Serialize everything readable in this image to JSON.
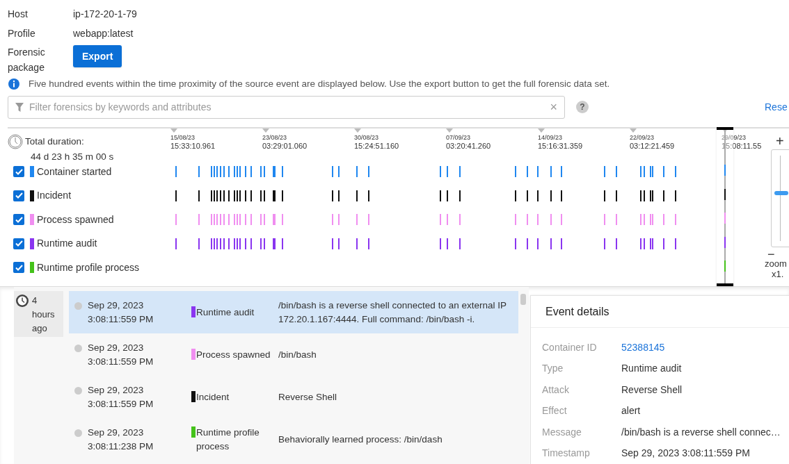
{
  "summary": [
    {
      "label": "Host",
      "value": "ip-172-20-1-79"
    },
    {
      "label": "Profile",
      "value": "webapp:latest"
    }
  ],
  "forensic_package": {
    "label": "Forensic package",
    "button": "Export"
  },
  "info": "Five hundred events within the time proximity of the source event are displayed below. Use the export button to get the full forensic data set.",
  "filter": {
    "placeholder": "Filter forensics by keywords and attributes",
    "clear": "×",
    "help": "?"
  },
  "reset": "Rese",
  "timeline": {
    "total_label": "Total duration:",
    "total_value": "44 d 23 h 35 m 00 s",
    "axis": [
      {
        "date": "15/08/23",
        "time": "15:33:10.961"
      },
      {
        "date": "23/08/23",
        "time": "03:29:01.060"
      },
      {
        "date": "30/08/23",
        "time": "15:24:51.160"
      },
      {
        "date": "07/09/23",
        "time": "03:20:41.260"
      },
      {
        "date": "14/09/23",
        "time": "15:16:31.359"
      },
      {
        "date": "22/09/23",
        "time": "03:12:21.459"
      },
      {
        "date": "29/09/23",
        "time": "15:08:11.55"
      }
    ],
    "series": [
      {
        "name": "Container started",
        "checked": true,
        "color": "#1f87f0"
      },
      {
        "name": "Incident",
        "checked": true,
        "color": "#111111"
      },
      {
        "name": "Process spawned",
        "checked": true,
        "color": "#f08ef0"
      },
      {
        "name": "Runtime audit",
        "checked": true,
        "color": "#8a35f0"
      },
      {
        "name": "Runtime profile process",
        "checked": true,
        "color": "#44c21a"
      }
    ],
    "zoom": {
      "plus": "+",
      "minus": "−",
      "label": "zoom",
      "value": "x1.",
      "level": 0.57
    }
  },
  "events": {
    "group": [
      "4",
      "hours",
      "ago"
    ],
    "rows": [
      {
        "date": "Sep 29, 2023",
        "time": "3:08:11:559 PM",
        "type": "Runtime audit",
        "color": "#8a35f0",
        "message": "/bin/bash is a reverse shell connected to an external IP 172.20.1.167:4444. Full command: /bin/bash -i.",
        "selected": true
      },
      {
        "date": "Sep 29, 2023",
        "time": "3:08:11:559 PM",
        "type": "Process spawned",
        "color": "#f08ef0",
        "message": "/bin/bash",
        "selected": false
      },
      {
        "date": "Sep 29, 2023",
        "time": "3:08:11:559 PM",
        "type": "Incident",
        "color": "#111111",
        "message": "Reverse Shell",
        "selected": false
      },
      {
        "date": "Sep 29, 2023",
        "time": "3:08:11:238 PM",
        "type": "Runtime profile process",
        "color": "#44c21a",
        "message": "Behaviorally learned process: /bin/dash",
        "selected": false
      }
    ]
  },
  "details": {
    "title": "Event details",
    "fields": [
      {
        "label": "Container ID",
        "value": "52388145",
        "kind": "link"
      },
      {
        "label": "Type",
        "value": "Runtime audit",
        "kind": "text"
      },
      {
        "label": "Attack",
        "value": "Reverse Shell",
        "kind": "text"
      },
      {
        "label": "Effect",
        "value": "alert",
        "kind": "text"
      },
      {
        "label": "Message",
        "value": "/bin/bash is a reverse shell connec…",
        "kind": "text"
      },
      {
        "label": "Timestamp",
        "value": "Sep 29, 2023 3:08:11:559 PM",
        "kind": "text"
      }
    ]
  }
}
